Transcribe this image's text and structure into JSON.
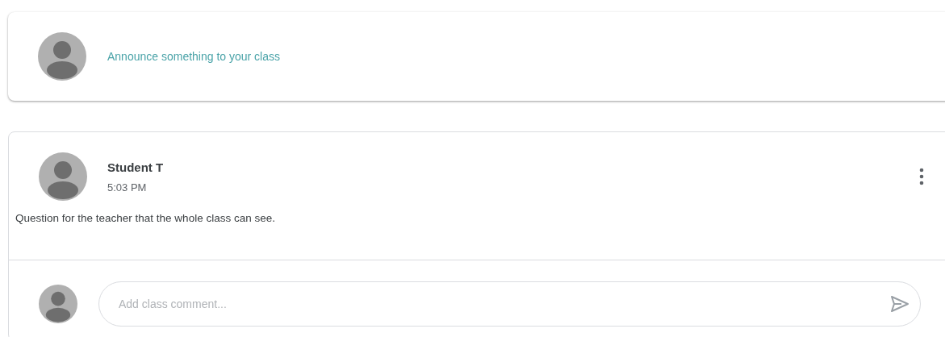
{
  "announce": {
    "placeholder": "Announce something to your class"
  },
  "post": {
    "author": "Student T",
    "time": "5:03 PM",
    "body": "Question for the teacher that the whole class can see."
  },
  "comment": {
    "placeholder": "Add class comment..."
  }
}
